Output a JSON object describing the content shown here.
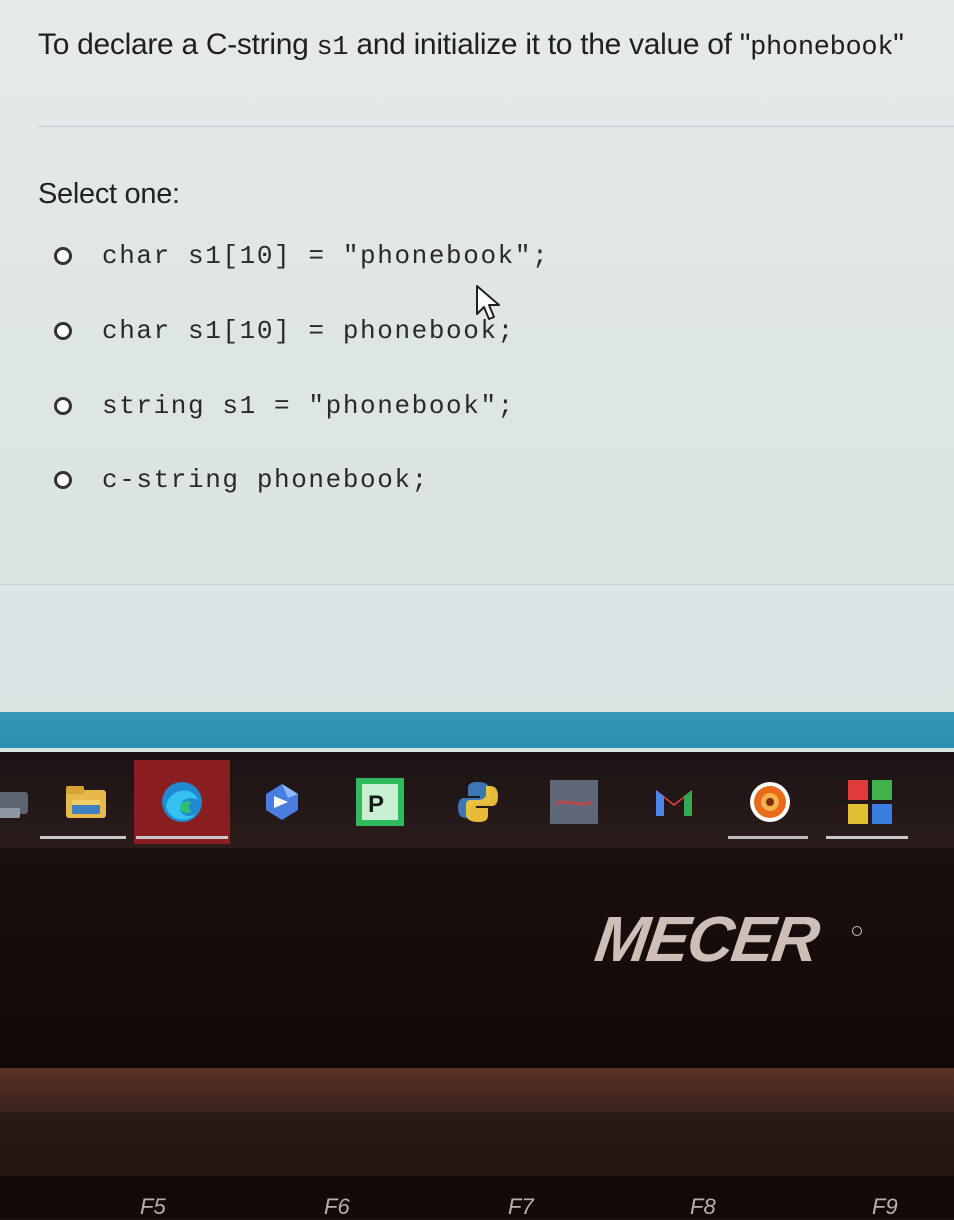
{
  "question": {
    "prefix": "To declare a C-string ",
    "variable": "s1",
    "middle": " and initialize it to the value of \"",
    "value": "phonebook",
    "suffix": "\""
  },
  "prompt": "Select one:",
  "options": [
    {
      "label": "char s1[10] = \"phonebook\";"
    },
    {
      "label": "char s1[10] = phonebook;"
    },
    {
      "label": "string s1 = \"phonebook\";"
    },
    {
      "label": "c-string phonebook;"
    }
  ],
  "taskbar": {
    "icons": [
      "file-explorer-icon",
      "edge-icon",
      "copilot-icon",
      "pycharm-icon",
      "python-icon",
      "app-window-icon",
      "gmail-icon",
      "media-player-icon",
      "app-grid-icon"
    ]
  },
  "bezel": {
    "brand": "MECER"
  },
  "keyboard": {
    "keys": [
      "F5",
      "F6",
      "F7",
      "F8",
      "F9"
    ]
  },
  "colors": {
    "accent_bar": "#3399b5",
    "taskbar_bg": "#1b1414"
  }
}
